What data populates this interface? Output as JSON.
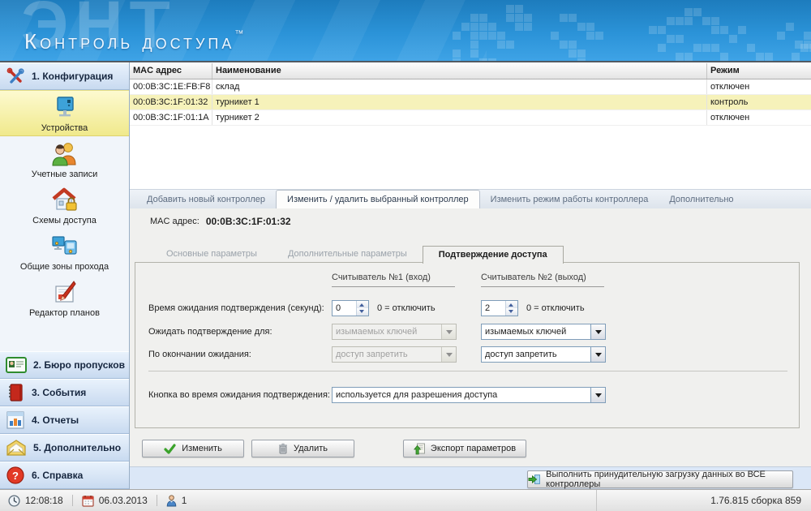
{
  "header": {
    "watermark": "ЭНТ",
    "logo": "Контроль доступа",
    "trademark": "™"
  },
  "sidebar": {
    "section_config": "1. Конфигурация",
    "items": [
      {
        "label": "Устройства"
      },
      {
        "label": "Учетные записи"
      },
      {
        "label": "Схемы доступа"
      },
      {
        "label": "Общие зоны прохода"
      },
      {
        "label": "Редактор планов"
      }
    ],
    "sections": [
      {
        "label": "2. Бюро пропусков"
      },
      {
        "label": "3. События"
      },
      {
        "label": "4. Отчеты"
      },
      {
        "label": "5. Дополнительно"
      },
      {
        "label": "6. Справка"
      }
    ]
  },
  "table": {
    "columns": [
      "MAC адрес",
      "Наименование",
      "Режим"
    ],
    "rows": [
      {
        "mac": "00:0B:3C:1E:FB:F8",
        "name": "склад",
        "mode": "отключен"
      },
      {
        "mac": "00:0B:3C:1F:01:32",
        "name": "турникет 1",
        "mode": "контроль"
      },
      {
        "mac": "00:0B:3C:1F:01:1A",
        "name": "турникет 2",
        "mode": "отключен"
      }
    ],
    "selected_row_index": 1
  },
  "tabs": {
    "main": [
      "Добавить новый контроллер",
      "Изменить / удалить выбранный контроллер",
      "Изменить режим работы контроллера",
      "Дополнительно"
    ],
    "active_main_index": 1,
    "inner": [
      "Основные параметры",
      "Дополнительные параметры",
      "Подтверждение доступа"
    ],
    "active_inner_index": 2
  },
  "panel": {
    "mac_label": "MAC адрес:",
    "mac_value": "00:0B:3C:1F:01:32",
    "reader1_header": "Считыватель №1 (вход)",
    "reader2_header": "Считыватель №2 (выход)",
    "wait_label": "Время ожидания подтверждения  (секунд):",
    "wait_reader1": "0",
    "wait_reader2": "2",
    "wait_hint": "0 = отключить",
    "confirm_label": "Ожидать подтверждение для:",
    "confirm_reader1": "изымаемых ключей",
    "confirm_reader2": "изымаемых ключей",
    "timeout_label": "По окончании ожидания:",
    "timeout_reader1": "доступ запретить",
    "timeout_reader2": "доступ запретить",
    "button_label": "Кнопка во время ожидания подтверждения:",
    "button_value": "используется для разрешения доступа"
  },
  "actions": {
    "edit": "Изменить",
    "delete": "Удалить",
    "export": "Экспорт параметров",
    "force_load": "Выполнить принудительную загрузку данных во ВСЕ контроллеры"
  },
  "statusbar": {
    "time": "12:08:18",
    "date": "06.03.2013",
    "users": "1",
    "version": "1.76.815 сборка 859"
  },
  "icons": {
    "wrench-icon": "crossed-tools",
    "device-monitor-icon": "monitor",
    "accounts-icon": "two-users",
    "access-schemes-icon": "house-lock",
    "common-zones-icon": "two-monitors",
    "plan-editor-icon": "pencil-document",
    "badge-office-icon": "id-card",
    "events-book-icon": "red-book",
    "reports-chart-icon": "bar-chart",
    "extra-envelope-icon": "envelope",
    "help-icon": "question-circle",
    "edit-check-icon": "green-check",
    "delete-trash-icon": "trash-can",
    "export-icon": "document-up-arrow",
    "force-load-icon": "green-arrow-document",
    "clock-icon": "clock",
    "calendar-icon": "calendar",
    "user-count-icon": "person",
    "spinner-up-icon": "triangle-up",
    "spinner-down-icon": "triangle-down",
    "dropdown-arrow-icon": "triangle-down"
  },
  "colors": {
    "header_blue": "#2b93d8",
    "selected_yellow": "#f6f2ba",
    "sidebar_selected_yellow": "#f0e98c",
    "section_blue": "#c8daf0",
    "panel_gray": "#f0f0ee",
    "strip_blue": "#dbe7f7"
  }
}
